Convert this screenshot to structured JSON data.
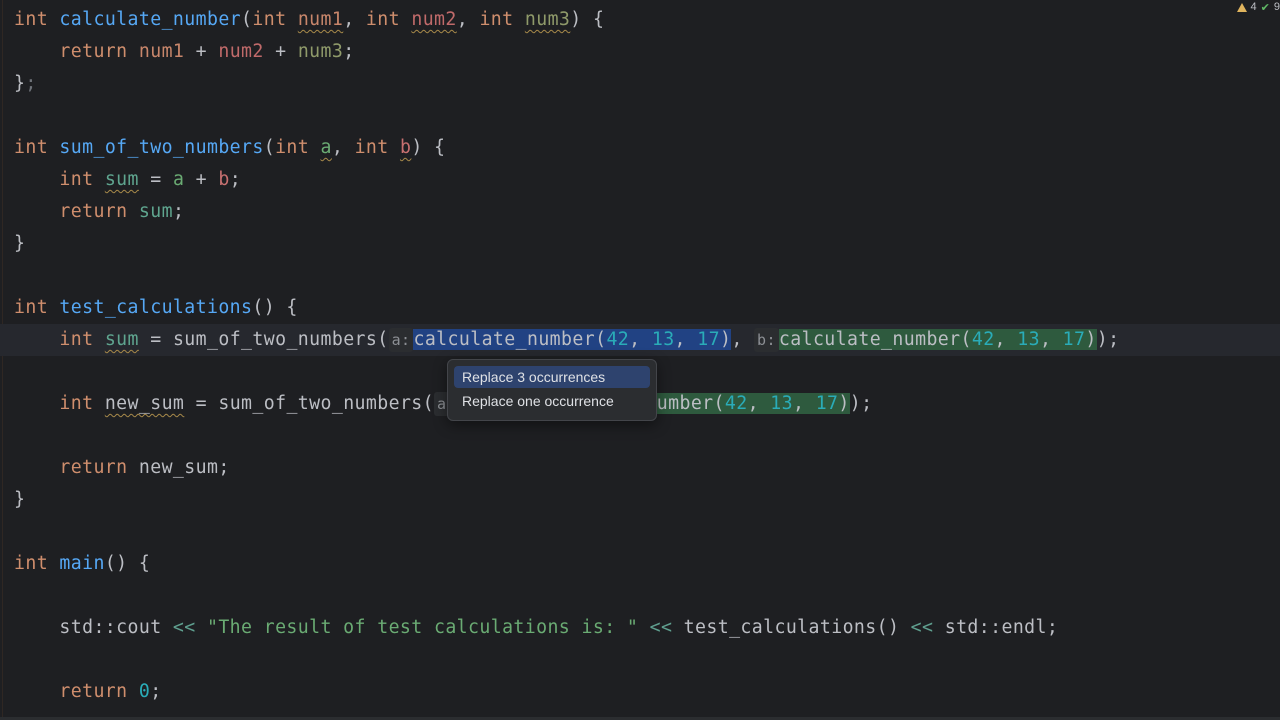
{
  "status": {
    "warning_icon": "warning-triangle-icon",
    "warning_count": "4",
    "ok_icon": "check-icon",
    "ok_count": "9"
  },
  "code": {
    "l1": {
      "kw1": "int",
      "fn": "calculate_number",
      "open": "(",
      "kw2": "int",
      "p1": "num1",
      "c1": ", ",
      "kw3": "int",
      "p2": "num2",
      "c2": ", ",
      "kw4": "int",
      "p3": "num3",
      "close": ") {"
    },
    "l2": {
      "kw": "return",
      "a": "num1",
      "op1": " + ",
      "b": "num2",
      "op2": " + ",
      "c": "num3",
      "semi": ";"
    },
    "l3": {
      "brace": "}",
      "semi": ";"
    },
    "l5": {
      "kw1": "int",
      "fn": "sum_of_two_numbers",
      "open": "(",
      "kw2": "int",
      "a": "a",
      "c1": ", ",
      "kw3": "int",
      "b": "b",
      "close": ") {"
    },
    "l6": {
      "kw": "int",
      "var": "sum",
      "eq": " = ",
      "a": "a",
      "op": " + ",
      "b": "b",
      "semi": ";"
    },
    "l7": {
      "kw": "return",
      "var": "sum",
      "semi": ";"
    },
    "l8": {
      "brace": "}"
    },
    "l10": {
      "kw": "int",
      "fn": "test_calculations",
      "rest": "() {"
    },
    "l11": {
      "kw": "int",
      "var": "sum",
      "eq": " = ",
      "call": "sum_of_two_numbers(",
      "hint_a": "a:",
      "sel_fn": "calculate_number(",
      "n1": "42",
      ",1": ", ",
      "n2": "13",
      ",2": ", ",
      "n3": "17",
      "sel_close": ")",
      "comma": ", ",
      "hint_b": "b:",
      "g_fn": "calculate_number(",
      "gn1": "42",
      "g,1": ", ",
      "gn2": "13",
      "g,2": ", ",
      "gn3": "17",
      "g_close": ")",
      "end": ");"
    },
    "l13": {
      "kw": "int",
      "var": "new_sum",
      "eq": " = ",
      "call": "sum_of_two_numbers(",
      "hint_a": "a",
      "g_fn": "number(",
      "gn1": "42",
      "g,1": ", ",
      "gn2": "13",
      "g,2": ", ",
      "gn3": "17",
      "g_close": ")",
      "end": ");"
    },
    "l15": {
      "kw": "return",
      "var": "new_sum",
      "semi": ";"
    },
    "l16": {
      "brace": "}"
    },
    "l18": {
      "kw": "int",
      "fn": "main",
      "rest": "() {"
    },
    "l20": {
      "a": "std::cout",
      "sh1": " << ",
      "str": "\"The result of test calculations is: \"",
      "sh2": " << ",
      "call": "test_calculations()",
      "sh3": " << ",
      "b": "std::endl",
      "semi": ";"
    },
    "l22": {
      "kw": "return",
      "num": "0",
      "semi": ";"
    }
  },
  "popup": {
    "items": [
      {
        "label": "Replace 3 occurrences",
        "selected": true
      },
      {
        "label": "Replace one occurrence",
        "selected": false
      }
    ]
  }
}
